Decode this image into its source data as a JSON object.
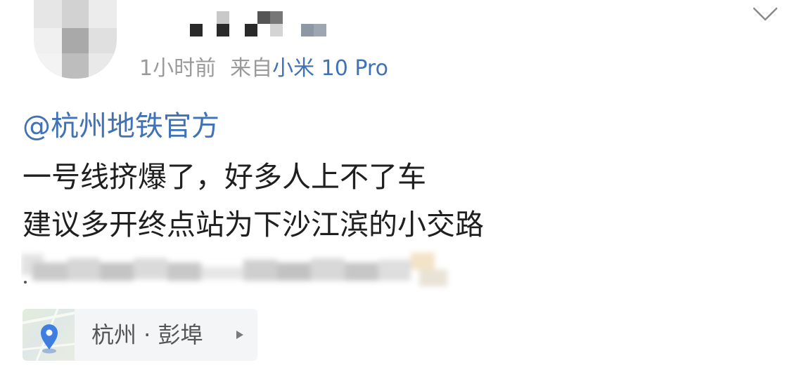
{
  "post": {
    "header": {
      "time": "1小时前",
      "source_prefix": "来自",
      "device": "小米 10 Pro"
    },
    "mention": "@杭州地铁官方",
    "lines": [
      "一号线挤爆了，好多人上不了车",
      "建议多开终点站为下沙江滨的小交路"
    ],
    "trailing_mark": ".",
    "location": {
      "label": "杭州 · 彭埠",
      "icon": "location-pin-icon",
      "arrow_icon": "caret-right-icon"
    }
  },
  "icons": {
    "collapse": "chevron-down-icon"
  },
  "colors": {
    "link": "#3f72b6",
    "meta": "#9a9a9a",
    "text": "#1f1f1f",
    "location_bg": "#f4f5f7",
    "pin": "#3d7ee0"
  }
}
